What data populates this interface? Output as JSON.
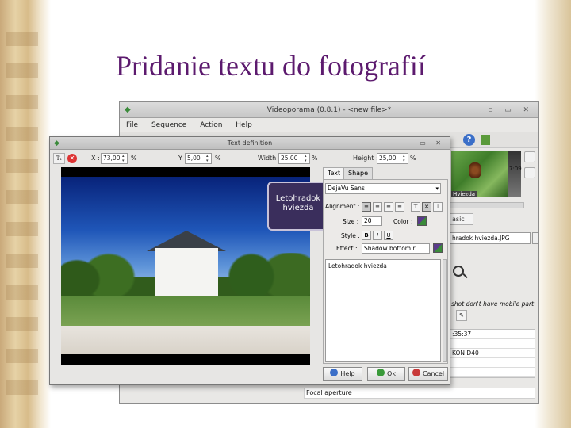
{
  "slide": {
    "title": "Pridanie textu do fotografií"
  },
  "main_window": {
    "title": "Videoporama (0.8.1) - <new file>*",
    "menu": [
      "File",
      "Sequence",
      "Action",
      "Help"
    ],
    "thumb_time": "7:09",
    "thumb_label": "Hviezda",
    "tab_fragment": "asic",
    "file_value": "hradok hviezda.JPG",
    "browse_label": "...",
    "mobile_note": "shot don't have mobile part",
    "info_rows": [
      ":35:37",
      "",
      "KON D40",
      "",
      ""
    ],
    "focal_label": "Focal aperture"
  },
  "dialog": {
    "title": "Text definition",
    "x_label": "X :",
    "x_value": "73,00",
    "x_unit": "%",
    "y_label": "Y :",
    "y_value": "5,00",
    "y_unit": "%",
    "width_label": "Width :",
    "width_value": "25,00",
    "width_unit": "%",
    "height_label": "Height :",
    "height_value": "25,00",
    "height_unit": "%",
    "tabs": [
      "Text",
      "Shape"
    ],
    "font": "DejaVu Sans",
    "alignment_label": "Alignment :",
    "size_label": "Size :",
    "size_value": "20",
    "color_label": "Color :",
    "style_label": "Style :",
    "style_buttons": [
      "B",
      "I",
      "U"
    ],
    "effect_label": "Effect :",
    "effect_value": "Shadow bottom r",
    "text_content": "Letohradok hviezda",
    "overlay_line1": "Letohradok",
    "overlay_line2": "hviezda",
    "help_label": "Help",
    "ok_label": "Ok",
    "cancel_label": "Cancel"
  }
}
